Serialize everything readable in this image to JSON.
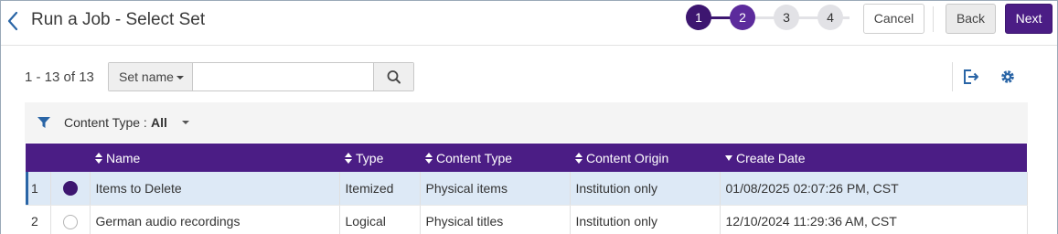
{
  "header": {
    "title": "Run a Job - Select Set",
    "steps": [
      "1",
      "2",
      "3",
      "4"
    ],
    "cancel_label": "Cancel",
    "back_label": "Back",
    "next_label": "Next"
  },
  "toolbar": {
    "record_count": "1 - 13 of 13",
    "search_field": "Set name",
    "search_value": "",
    "search_placeholder": ""
  },
  "filter": {
    "label": "Content Type :",
    "value": "All"
  },
  "table": {
    "columns": [
      "",
      "",
      "Name",
      "Type",
      "Content Type",
      "Content Origin",
      "Create Date"
    ],
    "rows": [
      {
        "num": "1",
        "selected": true,
        "name": "Items to Delete",
        "type": "Itemized",
        "content_type": "Physical items",
        "content_origin": "Institution only",
        "create_date": "01/08/2025 02:07:26 PM, CST"
      },
      {
        "num": "2",
        "selected": false,
        "name": "German audio recordings",
        "type": "Logical",
        "content_type": "Physical titles",
        "content_origin": "Institution only",
        "create_date": "12/10/2024 11:29:36 AM, CST"
      }
    ]
  },
  "icons": [
    "back-arrow-icon",
    "search-icon",
    "export-icon",
    "gear-icon",
    "filter-icon",
    "chevron-down-icon",
    "sort-icon",
    "sort-desc-icon"
  ],
  "colors": {
    "brand_purple": "#4b1d85",
    "step_done": "#3d1670",
    "step_current": "#5c2b9c",
    "step_todo": "#e2e2e6",
    "link_blue": "#2a65a6",
    "selected_row": "#dde9f6"
  }
}
